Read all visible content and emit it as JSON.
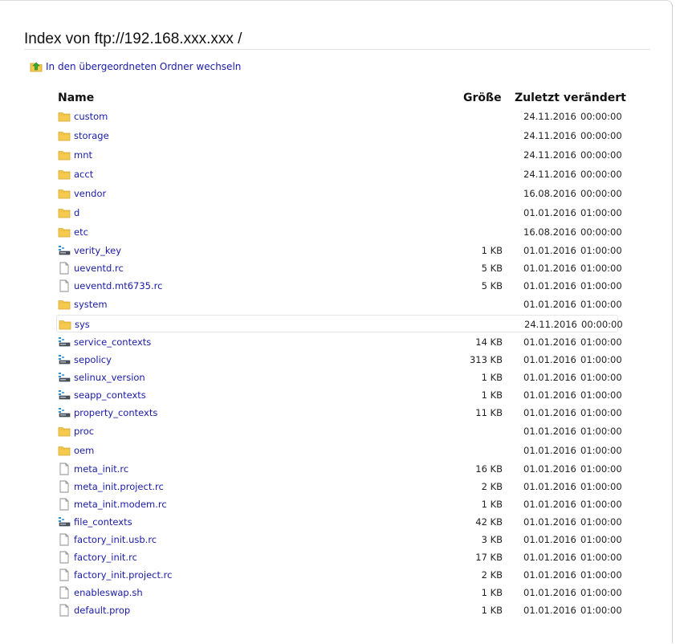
{
  "page": {
    "title": "Index von ftp://192.168.xxx.xxx           /",
    "up_link_label": "In den übergeordneten Ordner wechseln"
  },
  "table": {
    "headers": {
      "name": "Name",
      "size": "Größe",
      "modified": "Zuletzt verändert"
    },
    "rows": [
      {
        "name": "custom",
        "type": "folder",
        "size": "",
        "date": "24.11.2016",
        "time": "00:00:00"
      },
      {
        "name": "storage",
        "type": "folder",
        "size": "",
        "date": "24.11.2016",
        "time": "00:00:00"
      },
      {
        "name": "mnt",
        "type": "folder",
        "size": "",
        "date": "24.11.2016",
        "time": "00:00:00"
      },
      {
        "name": "acct",
        "type": "folder",
        "size": "",
        "date": "24.11.2016",
        "time": "00:00:00"
      },
      {
        "name": "vendor",
        "type": "folder",
        "size": "",
        "date": "16.08.2016",
        "time": "00:00:00"
      },
      {
        "name": "d",
        "type": "folder",
        "size": "",
        "date": "01.01.2016",
        "time": "01:00:00"
      },
      {
        "name": "etc",
        "type": "folder",
        "size": "",
        "date": "16.08.2016",
        "time": "00:00:00"
      },
      {
        "name": "verity_key",
        "type": "system",
        "size": "1 KB",
        "date": "01.01.2016",
        "time": "01:00:00"
      },
      {
        "name": "ueventd.rc",
        "type": "file",
        "size": "5 KB",
        "date": "01.01.2016",
        "time": "01:00:00"
      },
      {
        "name": "ueventd.mt6735.rc",
        "type": "file",
        "size": "5 KB",
        "date": "01.01.2016",
        "time": "01:00:00"
      },
      {
        "name": "system",
        "type": "folder",
        "size": "",
        "date": "01.01.2016",
        "time": "01:00:00"
      },
      {
        "name": "sys",
        "type": "folder",
        "size": "",
        "date": "24.11.2016",
        "time": "00:00:00",
        "highlight": true
      },
      {
        "name": "service_contexts",
        "type": "system",
        "size": "14 KB",
        "date": "01.01.2016",
        "time": "01:00:00"
      },
      {
        "name": "sepolicy",
        "type": "system",
        "size": "313 KB",
        "date": "01.01.2016",
        "time": "01:00:00"
      },
      {
        "name": "selinux_version",
        "type": "system",
        "size": "1 KB",
        "date": "01.01.2016",
        "time": "01:00:00"
      },
      {
        "name": "seapp_contexts",
        "type": "system",
        "size": "1 KB",
        "date": "01.01.2016",
        "time": "01:00:00"
      },
      {
        "name": "property_contexts",
        "type": "system",
        "size": "11 KB",
        "date": "01.01.2016",
        "time": "01:00:00"
      },
      {
        "name": "proc",
        "type": "folder",
        "size": "",
        "date": "01.01.2016",
        "time": "01:00:00"
      },
      {
        "name": "oem",
        "type": "folder",
        "size": "",
        "date": "01.01.2016",
        "time": "01:00:00"
      },
      {
        "name": "meta_init.rc",
        "type": "file",
        "size": "16 KB",
        "date": "01.01.2016",
        "time": "01:00:00"
      },
      {
        "name": "meta_init.project.rc",
        "type": "file",
        "size": "2 KB",
        "date": "01.01.2016",
        "time": "01:00:00"
      },
      {
        "name": "meta_init.modem.rc",
        "type": "file",
        "size": "1 KB",
        "date": "01.01.2016",
        "time": "01:00:00"
      },
      {
        "name": "file_contexts",
        "type": "system",
        "size": "42 KB",
        "date": "01.01.2016",
        "time": "01:00:00"
      },
      {
        "name": "factory_init.usb.rc",
        "type": "file",
        "size": "3 KB",
        "date": "01.01.2016",
        "time": "01:00:00"
      },
      {
        "name": "factory_init.rc",
        "type": "file",
        "size": "17 KB",
        "date": "01.01.2016",
        "time": "01:00:00"
      },
      {
        "name": "factory_init.project.rc",
        "type": "file",
        "size": "2 KB",
        "date": "01.01.2016",
        "time": "01:00:00"
      },
      {
        "name": "enableswap.sh",
        "type": "file",
        "size": "1 KB",
        "date": "01.01.2016",
        "time": "01:00:00"
      },
      {
        "name": "default.prop",
        "type": "file",
        "size": "1 KB",
        "date": "01.01.2016",
        "time": "01:00:00"
      }
    ]
  },
  "icons": {
    "folder": "folder-icon",
    "file": "file-icon",
    "system": "system-file-icon",
    "up": "up-folder-icon"
  },
  "colors": {
    "link": "#1a1aa6",
    "folder_fill": "#f5c94e",
    "text": "#222222"
  }
}
